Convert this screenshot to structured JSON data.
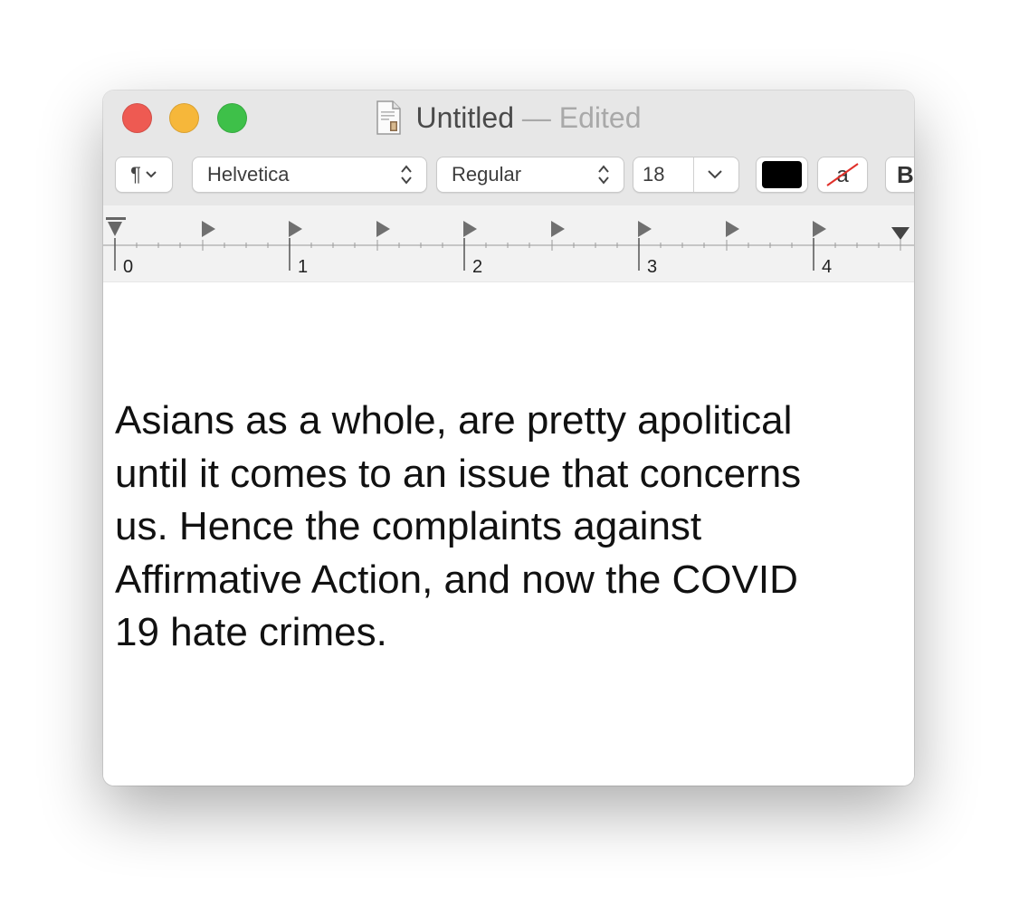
{
  "window": {
    "title": "Untitled",
    "title_separator": "—",
    "status": "Edited",
    "doc_icon": "text-document-icon"
  },
  "toolbar": {
    "paragraph_glyph": "¶",
    "font_family": "Helvetica",
    "font_style": "Regular",
    "font_size": "18",
    "text_color": "#000000",
    "background_color_icon": "a",
    "bold_label": "B"
  },
  "ruler": {
    "marks": [
      "0",
      "1",
      "2",
      "3",
      "4"
    ]
  },
  "document": {
    "text": "Asians as a whole, are pretty apolitical\nuntil it comes to an issue that concerns\nus. Hence the complaints against\nAffirmative Action, and now the COVID\n19 hate crimes."
  },
  "colors": {
    "close": "#ee5a52",
    "minimize": "#f6b73a",
    "zoom": "#3ec049"
  }
}
